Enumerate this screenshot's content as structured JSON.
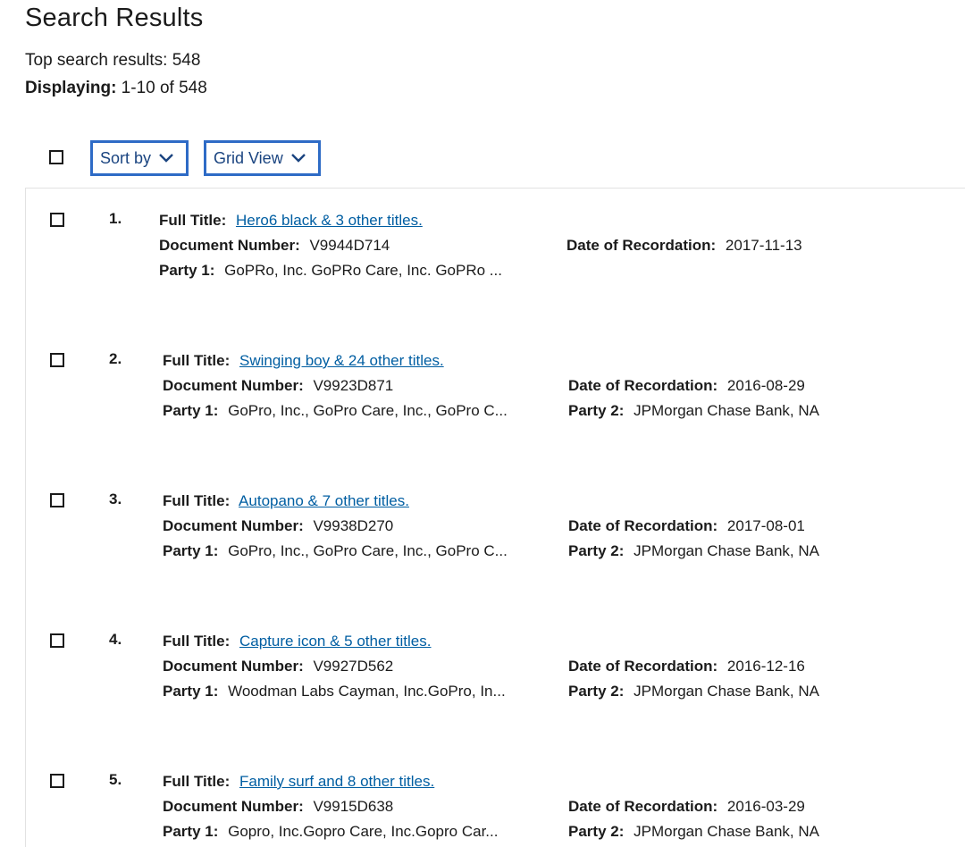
{
  "header": {
    "title": "Search Results",
    "top_results_text": "Top search results: 548",
    "displaying_label": "Displaying:",
    "displaying_value": " 1-10 of 548"
  },
  "toolbar": {
    "sort_label": "Sort by",
    "view_label": "Grid View"
  },
  "labels": {
    "full_title": "Full Title:",
    "document_number": "Document Number:",
    "party1": "Party 1:",
    "date_of_recordation": "Date of Recordation:",
    "party2": "Party 2:"
  },
  "results": [
    {
      "num": "1.",
      "title": "Hero6 black & 3 other titles.",
      "document_number": "V9944D714",
      "party1": "GoPRo, Inc. GoPRo Care, Inc. GoPRo ...",
      "date": "2017-11-13",
      "party2": ""
    },
    {
      "num": "2.",
      "title": "Swinging boy & 24 other titles.",
      "document_number": "V9923D871",
      "party1": "GoPro, Inc., GoPro Care, Inc., GoPro C...",
      "date": "2016-08-29",
      "party2": "JPMorgan Chase Bank, NA"
    },
    {
      "num": "3.",
      "title": "Autopano & 7 other titles.",
      "document_number": "V9938D270",
      "party1": "GoPro, Inc., GoPro Care, Inc., GoPro C...",
      "date": "2017-08-01",
      "party2": "JPMorgan Chase Bank, NA"
    },
    {
      "num": "4.",
      "title": "Capture icon & 5 other titles.",
      "document_number": "V9927D562",
      "party1": "Woodman Labs Cayman, Inc.GoPro, In...",
      "date": "2016-12-16",
      "party2": "JPMorgan Chase Bank, NA"
    },
    {
      "num": "5.",
      "title": "Family surf and 8 other titles.",
      "document_number": "V9915D638",
      "party1": "Gopro, Inc.Gopro Care, Inc.Gopro Car...",
      "date": "2016-03-29",
      "party2": "JPMorgan Chase Bank, NA"
    }
  ]
}
